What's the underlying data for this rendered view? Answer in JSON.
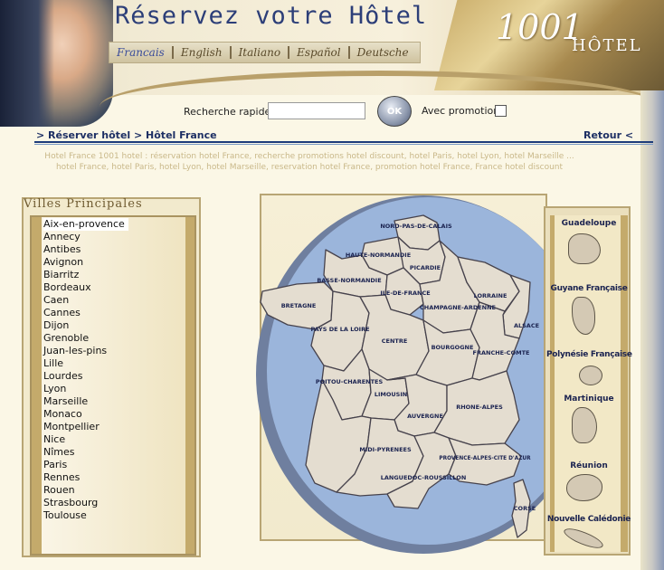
{
  "header": {
    "title": "Réservez votre Hôtel",
    "logo_number": "1001",
    "logo_word": "HÔTEL",
    "languages": [
      "Francais",
      "English",
      "Italiano",
      "Español",
      "Deutsche"
    ],
    "active_language": "Francais"
  },
  "search": {
    "label": "Recherche rapide",
    "input_value": "",
    "button_label": "OK",
    "promo_label": "Avec promotion",
    "promo_checked": false
  },
  "breadcrumb": {
    "path": "> Réserver hôtel > Hôtel France",
    "back": "Retour <"
  },
  "seo_text": {
    "line1": "Hotel France 1001 hotel : réservation hotel France, recherche promotions hotel discount, hotel Paris, hotel Lyon, hotel Marseille ...",
    "line2": "hotel France, hotel Paris, hotel Lyon, hotel Marseille, reservation hotel France, promotion hotel France, France hotel discount"
  },
  "cities": {
    "title": "Villes Principales",
    "items": [
      "Aix-en-provence",
      "Annecy",
      "Antibes",
      "Avignon",
      "Biarritz",
      "Bordeaux",
      "Caen",
      "Cannes",
      "Dijon",
      "Grenoble",
      "Juan-les-pins",
      "Lille",
      "Lourdes",
      "Lyon",
      "Marseille",
      "Monaco",
      "Montpellier",
      "Nice",
      "Nîmes",
      "Paris",
      "Rennes",
      "Rouen",
      "Strasbourg",
      "Toulouse"
    ]
  },
  "map": {
    "regions": {
      "nord": "NORD-PAS-DE-CALAIS",
      "haute_normandie": "HAUTE-NORMANDIE",
      "picardie": "PICARDIE",
      "basse_normandie": "BASSE-NORMANDIE",
      "bretagne": "BRETAGNE",
      "ile_de_france": "ILE-DE-FRANCE",
      "lorraine": "LORRAINE",
      "champagne": "CHAMPAGNE-ARDENNE",
      "alsace": "ALSACE",
      "pays_loire": "PAYS DE LA LOIRE",
      "centre": "CENTRE",
      "bourgogne": "BOURGOGNE",
      "franche_comte": "FRANCHE-COMTE",
      "poitou": "POITOU-CHARENTES",
      "limousin": "LIMOUSIN",
      "auvergne": "AUVERGNE",
      "rhone_alpes": "RHONE-ALPES",
      "midi_pyrenees": "MIDI-PYRENEES",
      "languedoc": "LANGUEDOC-ROUSSILLON",
      "paca": "PROVENCE-ALPES-CITE D'AZUR",
      "corse": "CORSE"
    },
    "colors": {
      "land": "#e4ddd0",
      "sea": "#9bb5db",
      "border": "#46424c",
      "label": "#1b2350"
    }
  },
  "overseas": {
    "items": [
      "Guadeloupe",
      "Guyane Française",
      "Polynésie Française",
      "Martinique",
      "Réunion",
      "Nouvelle Calédonie"
    ]
  }
}
